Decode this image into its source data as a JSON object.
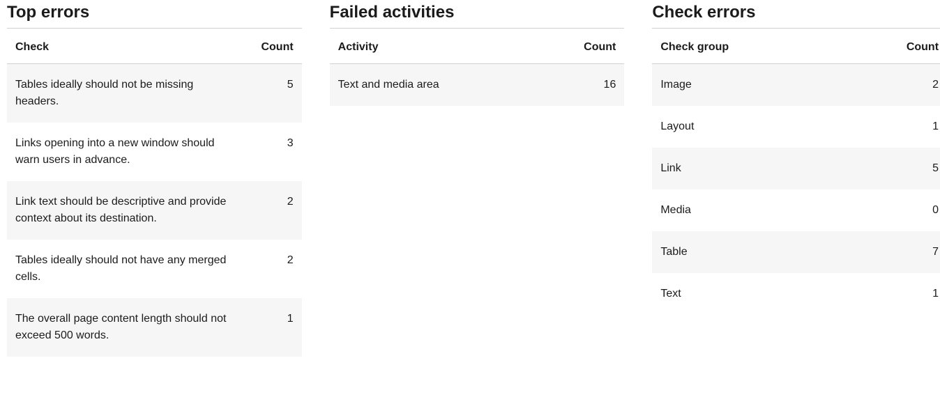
{
  "panels": {
    "top_errors": {
      "title": "Top errors",
      "columns": {
        "label": "Check",
        "count": "Count"
      },
      "rows": [
        {
          "label": "Tables ideally should not be missing headers.",
          "count": "5"
        },
        {
          "label": "Links opening into a new window should warn users in advance.",
          "count": "3"
        },
        {
          "label": "Link text should be descriptive and provide context about its destination.",
          "count": "2"
        },
        {
          "label": "Tables ideally should not have any merged cells.",
          "count": "2"
        },
        {
          "label": "The overall page content length should not exceed 500 words.",
          "count": "1"
        }
      ]
    },
    "failed_activities": {
      "title": "Failed activities",
      "columns": {
        "label": "Activity",
        "count": "Count"
      },
      "rows": [
        {
          "label": "Text and media area",
          "count": "16"
        }
      ]
    },
    "check_errors": {
      "title": "Check errors",
      "columns": {
        "label": "Check group",
        "count": "Count"
      },
      "rows": [
        {
          "label": "Image",
          "count": "2"
        },
        {
          "label": "Layout",
          "count": "1"
        },
        {
          "label": "Link",
          "count": "5"
        },
        {
          "label": "Media",
          "count": "0"
        },
        {
          "label": "Table",
          "count": "7"
        },
        {
          "label": "Text",
          "count": "1"
        }
      ]
    }
  }
}
